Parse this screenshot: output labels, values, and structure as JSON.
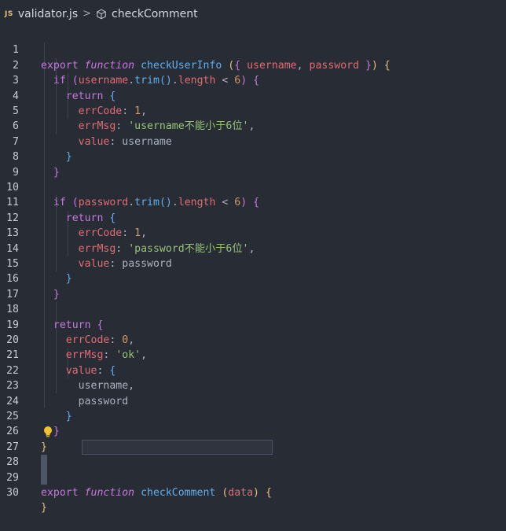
{
  "breadcrumb": {
    "file_badge": "JS",
    "file_name": "validator.js",
    "separator": ">",
    "symbol_name": "checkComment"
  },
  "editor": {
    "line_numbers": [
      "1",
      "2",
      "3",
      "4",
      "5",
      "6",
      "7",
      "8",
      "9",
      "10",
      "11",
      "12",
      "13",
      "14",
      "15",
      "16",
      "17",
      "18",
      "19",
      "20",
      "21",
      "22",
      "23",
      "24",
      "25",
      "26",
      "27",
      "28",
      "29",
      "30"
    ],
    "lines": [
      "export function checkUserInfo ({ username, password }) {",
      "  if (username.trim().length < 6) {",
      "    return {",
      "      errCode: 1,",
      "      errMsg: 'username不能小于6位',",
      "      value: username",
      "    }",
      "  }",
      "",
      "  if (password.trim().length < 6) {",
      "    return {",
      "      errCode: 1,",
      "      errMsg: 'password不能小于6位',",
      "      value: password",
      "    }",
      "  }",
      "",
      "  return {",
      "    errCode: 0,",
      "    errMsg: 'ok',",
      "    value: {",
      "      username,",
      "      password",
      "    }",
      "  }",
      "}",
      "",
      "export function checkComment (data) {",
      "",
      "}"
    ],
    "lightbulb_icon": "lightbulb-icon"
  },
  "colors": {
    "background": "#282c34",
    "keyword": "#c678dd",
    "function": "#61afef",
    "variable": "#e06c75",
    "number": "#d19a66",
    "string": "#98c379"
  }
}
